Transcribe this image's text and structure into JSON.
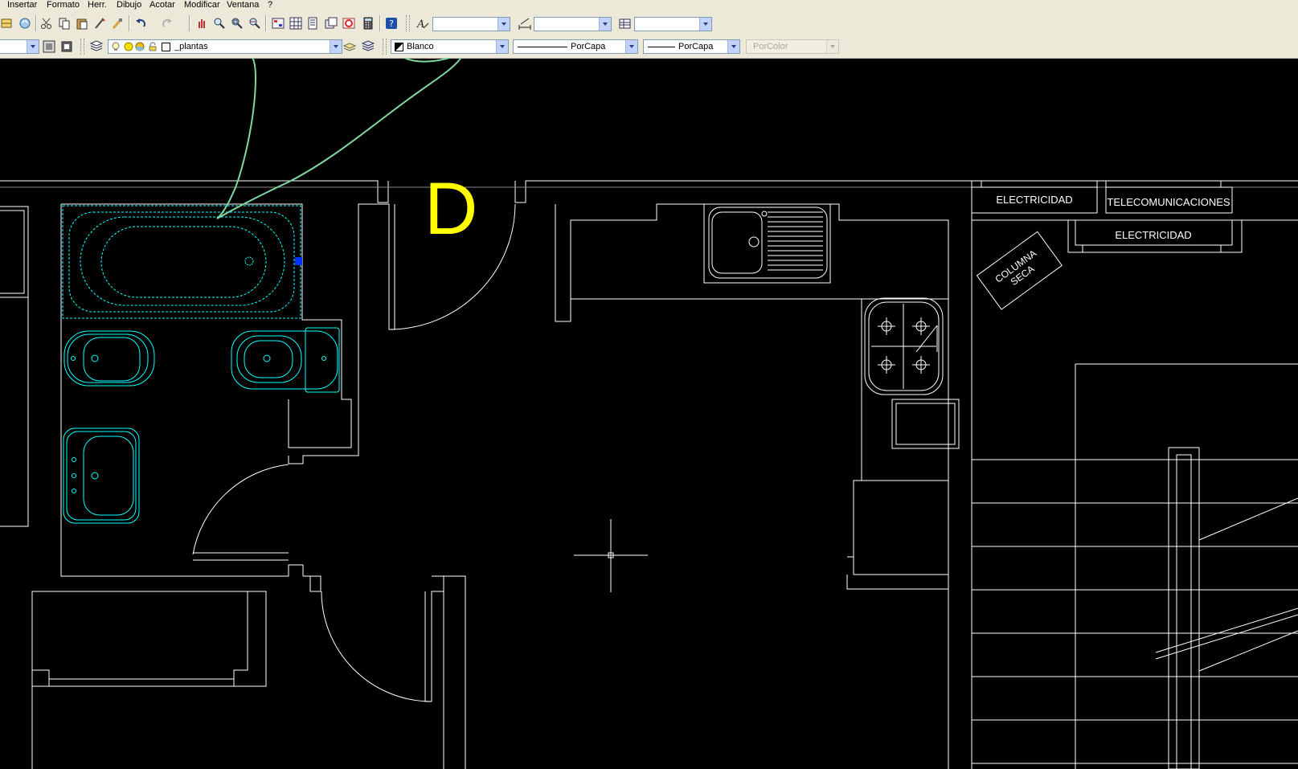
{
  "menu": {
    "items": [
      "Insertar",
      "Formato",
      "Herr.",
      "Dibujo",
      "Acotar",
      "Modificar",
      "Ventana",
      "?"
    ]
  },
  "layer_combo": {
    "value": "_plantas"
  },
  "color_combo": {
    "value": "Blanco"
  },
  "linetype_combo": {
    "value": "PorCapa"
  },
  "lineweight_combo": {
    "value": "PorCapa"
  },
  "plotstyle_combo": {
    "value": "PorColor"
  },
  "drawing": {
    "unit_label": "D",
    "labels": {
      "electricidad_1": "ELECTRICIDAD",
      "telecomunicaciones": "TELECOMUNICACIONES",
      "electricidad_2": "ELECTRICIDAD",
      "columna": "COLUMNA",
      "seca": "SECA"
    }
  },
  "colors": {
    "ui_face": "#ece9d8",
    "model_bg": "#000000",
    "lines": "#ffffff",
    "fixtures": "#00ffff",
    "unit_label": "#ffff00",
    "annotation": "#7fd8a0",
    "grip": "#0033ff"
  },
  "icons": {
    "toolbar_row1": [
      "insert-block-icon",
      "refresh-icon",
      "cut-icon",
      "copy-icon",
      "paste-icon",
      "match-properties-icon",
      "brush-icon",
      "undo-icon",
      "redo-icon",
      "pan-realtime-icon",
      "zoom-realtime-icon",
      "zoom-window-icon",
      "zoom-previous-icon",
      "properties-icon",
      "design-center-icon",
      "tool-palettes-icon",
      "sheet-set-icon",
      "markup-icon",
      "calculator-icon",
      "help-icon",
      "text-style-icon",
      "dim-style-icon",
      "table-style-icon"
    ],
    "toolbar_row2": [
      "layer-manager-icon",
      "layer-state-icon",
      "layers-icon",
      "bulb-icon",
      "sun-icon",
      "lock-icon",
      "color-swatch-icon",
      "make-current-icon",
      "layer-previous-icon"
    ]
  }
}
